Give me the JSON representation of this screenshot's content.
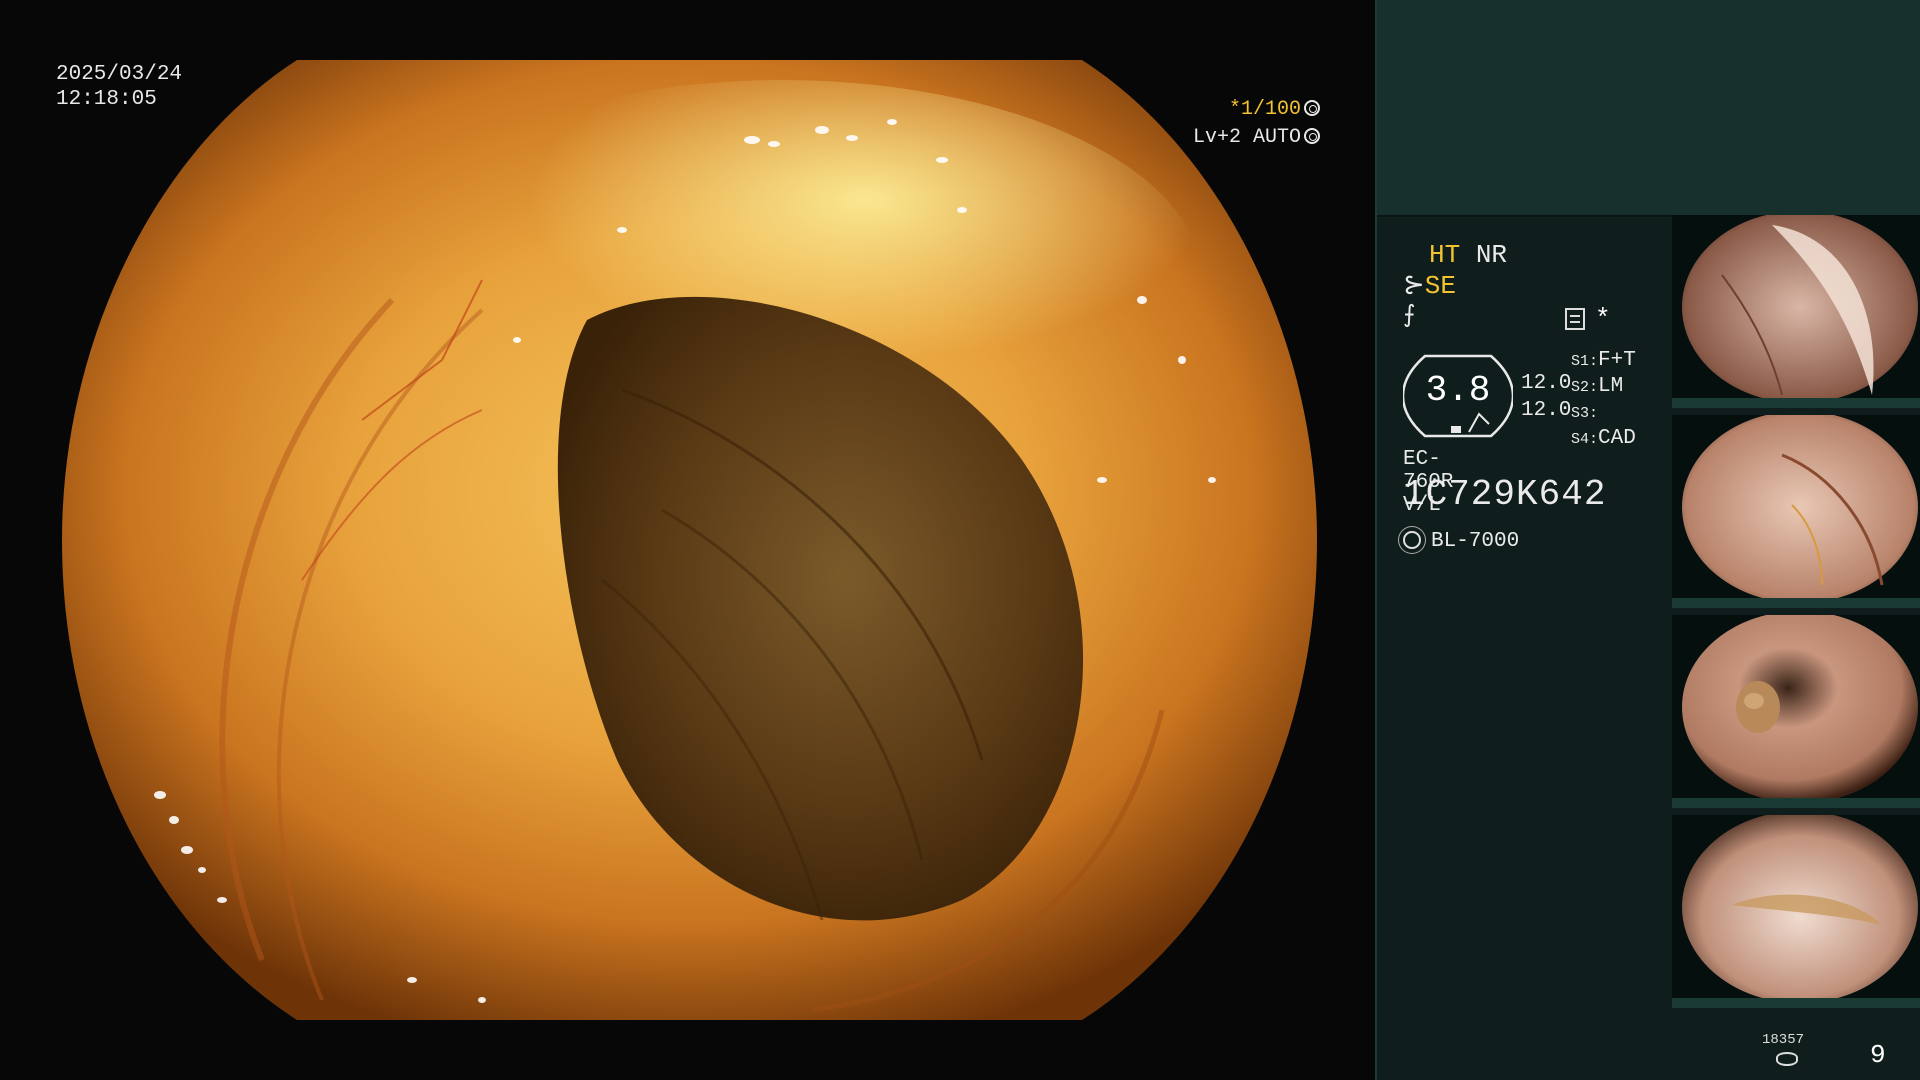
{
  "overlay": {
    "date": "2025/03/24",
    "time": "12:18:05",
    "shutter": "*1/100",
    "level": "Lv+2 AUTO"
  },
  "panel": {
    "ht": "HT",
    "nr": "NR",
    "se": "SE",
    "f_symbol": "⨍",
    "star": "*",
    "gauge_value": "3.8",
    "num1": "12.0",
    "num2": "12.0",
    "slots": [
      {
        "label": "S1:",
        "value": "F+T"
      },
      {
        "label": "S2:",
        "value": "LM"
      },
      {
        "label": "S3:",
        "value": ""
      },
      {
        "label": "S4:",
        "value": "CAD"
      }
    ],
    "scope_model": "EC-760R-V/L",
    "scope_serial": "1C729K642",
    "light_source": "BL-7000",
    "record_count": "18357",
    "page": "9"
  },
  "icons": [
    "shutter-mode-icon",
    "auto-level-icon",
    "mode-list-icon",
    "light-source-icon",
    "storage-disk-icon"
  ],
  "colors": {
    "accent_yellow": "#f2c230",
    "panel_bg": "#0f1e1c",
    "panel_top": "#17302b"
  }
}
